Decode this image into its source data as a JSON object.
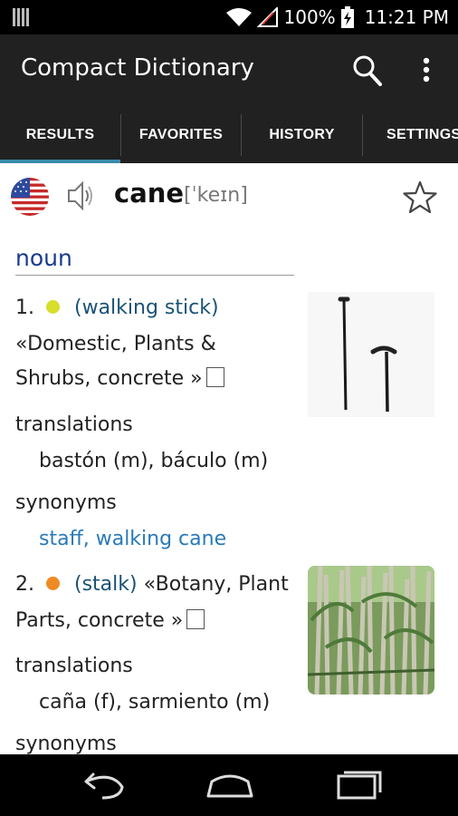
{
  "status_bar": {
    "battery": "100%",
    "time": "11:21 PM",
    "icons": [
      "bars-icon",
      "wifi-icon",
      "no-signal-icon",
      "battery-charging-icon"
    ]
  },
  "app": {
    "title": "Compact Dictionary",
    "icons": [
      "search-icon",
      "overflow-menu-icon"
    ]
  },
  "tabs": [
    {
      "label": "RESULTS",
      "active": true
    },
    {
      "label": "FAVORITES",
      "active": false
    },
    {
      "label": "HISTORY",
      "active": false
    },
    {
      "label": "SETTINGS",
      "active": false
    }
  ],
  "accent_color": "#3b8bab",
  "entry": {
    "headword": "cane",
    "phonetic": "[ˈkeɪn]",
    "part_of_speech": "noun",
    "icons": [
      "us-flag-icon",
      "speaker-icon",
      "star-icon"
    ],
    "senses": [
      {
        "number": "1.",
        "dot_color": "#d7de2c",
        "gloss": "(walking stick)",
        "domain_line1": "«Domestic, Plants &",
        "domain_line2": "Shrubs, concrete »",
        "translations_label": "translations",
        "translations": "bastón (m), báculo (m)",
        "synonyms_label": "synonyms",
        "synonyms": "staff, walking cane"
      },
      {
        "number": "2.",
        "dot_color": "#f08a24",
        "gloss": "(stalk)",
        "domain_line1": "«Botany, Plant",
        "domain_line2": "Parts, concrete »",
        "translations_label": "translations",
        "translations": "caña (f), sarmiento (m)",
        "synonyms_label": "synonyms"
      }
    ]
  },
  "nav": [
    "back-icon",
    "home-icon",
    "recents-icon"
  ]
}
